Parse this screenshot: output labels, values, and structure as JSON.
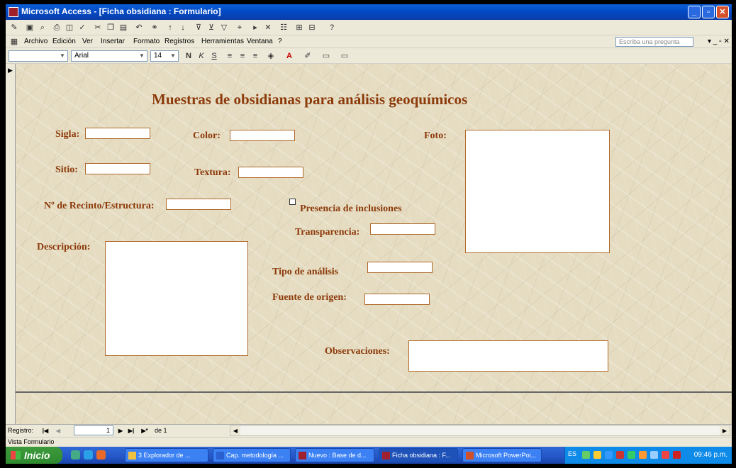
{
  "window": {
    "title": "Microsoft Access - [Ficha obsidiana : Formulario]",
    "min_icon": "minimize-icon",
    "max_icon": "restore-icon",
    "close_icon": "close-icon"
  },
  "menu": {
    "items": [
      "Archivo",
      "Edición",
      "Ver",
      "Insertar",
      "Formato",
      "Registros",
      "Herramientas",
      "Ventana",
      "?"
    ],
    "ask_placeholder": "Escriba una pregunta"
  },
  "format_toolbar": {
    "object_combo": "",
    "font": "Arial",
    "size": "14",
    "bold": "N",
    "italic": "K",
    "underline": "S"
  },
  "form": {
    "heading": "Muestras de obsidianas para análisis geoquímicos",
    "labels": {
      "sigla": "Sigla:",
      "color": "Color:",
      "foto": "Foto:",
      "sitio": "Sitio:",
      "textura": "Textura:",
      "recinto": "Nº de Recinto/Estructura:",
      "presencia": "Presencia de inclusiones",
      "transparencia": "Transparencia:",
      "descripcion": "Descripción:",
      "tipo": "Tipo de análisis",
      "fuente": "Fuente de origen:",
      "observaciones": "Observaciones:"
    },
    "values": {
      "sigla": "",
      "color": "",
      "sitio": "",
      "textura": "",
      "recinto": "",
      "transparencia": "",
      "descripcion": "",
      "tipo": "",
      "fuente": "",
      "observaciones": ""
    },
    "presencia_checked": false
  },
  "navigation": {
    "label": "Registro:",
    "current": "1",
    "of_text": "de 1"
  },
  "status": "Vista Formulario",
  "taskbar": {
    "start": "Inicio",
    "tasks": [
      "3 Explorador de ...",
      "Cap. metodología ...",
      "Nuevo : Base de d...",
      "Ficha obsidiana : F...",
      "Microsoft PowerPoi..."
    ],
    "lang": "ES",
    "clock": "09:46 p.m."
  },
  "colors": {
    "label_brown": "#8c3a0a",
    "form_texture": "#e5dcc2",
    "titlebar_blue": "#0a5fd8"
  }
}
